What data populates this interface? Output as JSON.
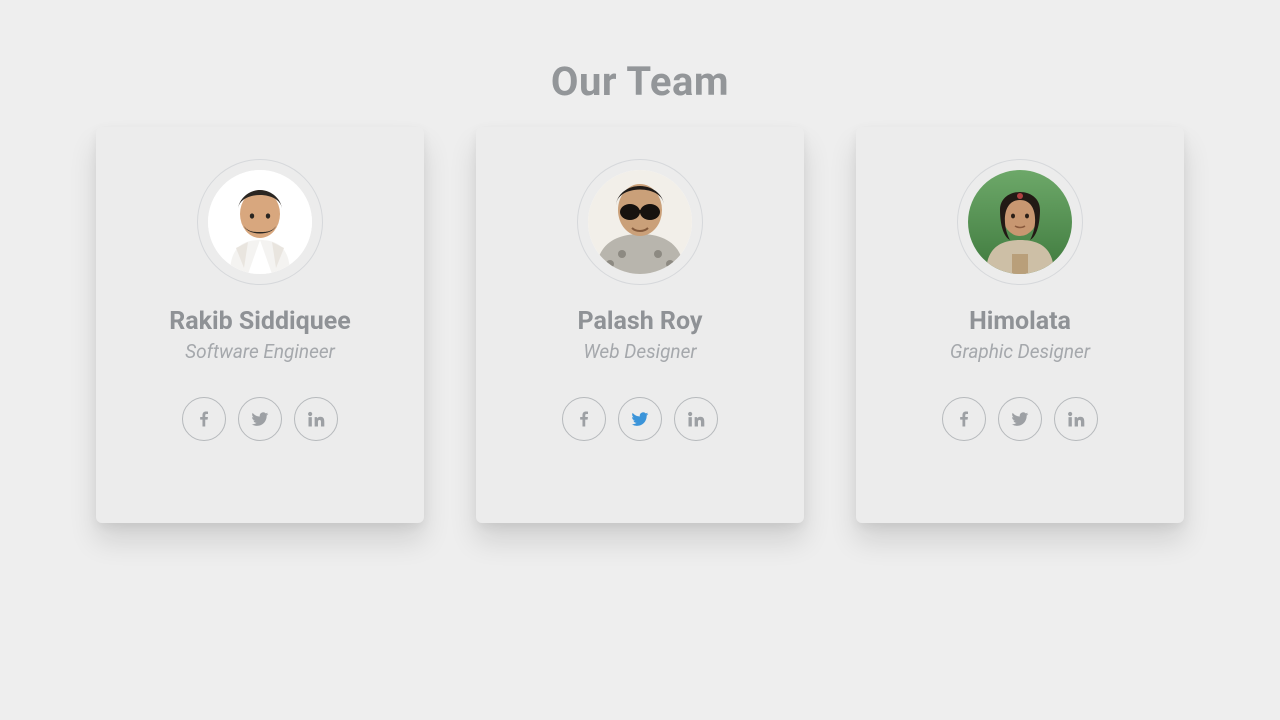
{
  "title": "Our Team",
  "members": [
    {
      "name": "Rakib Siddiquee",
      "role": "Software Engineer"
    },
    {
      "name": "Palash Roy",
      "role": "Web Designer"
    },
    {
      "name": "Himolata",
      "role": "Graphic Designer"
    }
  ],
  "social_labels": {
    "facebook": "facebook",
    "twitter": "twitter",
    "linkedin": "linkedin"
  },
  "highlighted_social": {
    "member_index": 1,
    "network": "twitter"
  }
}
